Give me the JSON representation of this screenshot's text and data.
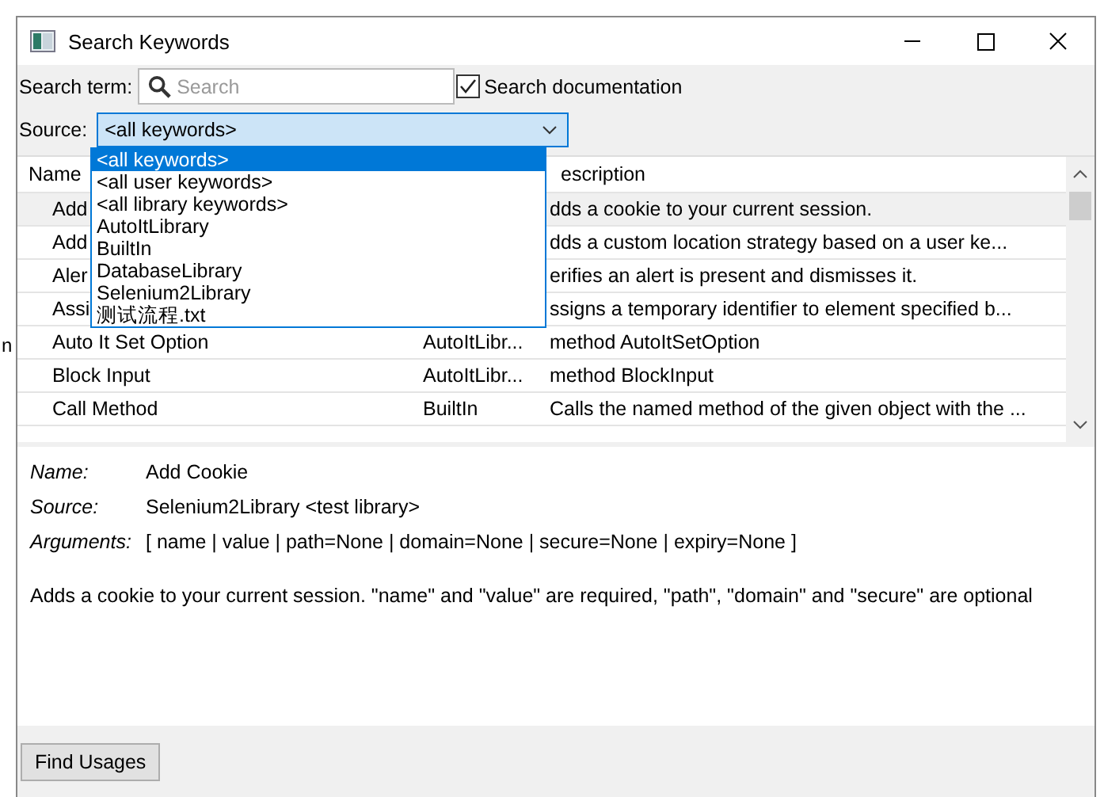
{
  "background": {
    "fragment": "n"
  },
  "window": {
    "title": "Search Keywords"
  },
  "search": {
    "label": "Search term:",
    "placeholder": "Search",
    "documentation": {
      "label": "Search documentation",
      "checked": true
    }
  },
  "source": {
    "label": "Source:",
    "value": "<all keywords>",
    "expanded": true,
    "options": [
      {
        "label": "<all keywords>",
        "selected": true
      },
      {
        "label": "<all user keywords>",
        "selected": false
      },
      {
        "label": "<all library keywords>",
        "selected": false
      },
      {
        "label": "AutoItLibrary",
        "selected": false
      },
      {
        "label": "BuiltIn",
        "selected": false
      },
      {
        "label": "DatabaseLibrary",
        "selected": false
      },
      {
        "label": "Selenium2Library",
        "selected": false
      },
      {
        "label": "测试流程.txt",
        "selected": false
      }
    ]
  },
  "table": {
    "name_header": "Name",
    "description_header": "escription",
    "rows": [
      {
        "name": "Add",
        "description": "dds a cookie to your current session.",
        "selected": true
      },
      {
        "name": "Add",
        "description": "dds a custom location strategy based on a user ke...",
        "selected": false
      },
      {
        "name": "Aler",
        "description": "erifies an alert is present and dismisses it.",
        "selected": false
      },
      {
        "name": "Assi",
        "description": "ssigns a temporary identifier to element specified b...",
        "selected": false
      },
      {
        "name": "Auto It Set Option",
        "source": "AutoItLibr...",
        "description": "method AutoItSetOption",
        "selected": false
      },
      {
        "name": "Block Input",
        "source": "AutoItLibr...",
        "description": "method BlockInput",
        "selected": false
      },
      {
        "name": "Call Method",
        "source": "BuiltIn",
        "description": "Calls the named method of the given object with the ...",
        "selected": false
      }
    ]
  },
  "details": {
    "fields": [
      {
        "label": "Name:",
        "value": "Add Cookie"
      },
      {
        "label": "Source:",
        "value": "Selenium2Library <test library>"
      },
      {
        "label": "Arguments:",
        "value": "[ name | value | path=None | domain=None | secure=None | expiry=None ]"
      }
    ],
    "text": "Adds a cookie to your current session. \"name\" and \"value\" are required, \"path\", \"domain\" and \"secure\" are optional"
  },
  "buttons": [
    "Find Usages"
  ]
}
